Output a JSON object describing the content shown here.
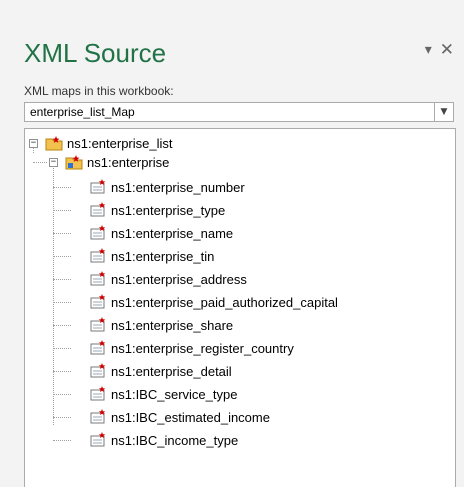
{
  "pane": {
    "title": "XML Source",
    "maps_label": "XML maps in this workbook:",
    "selected_map": "enterprise_list_Map"
  },
  "tree": {
    "root": "ns1:enterprise_list",
    "child": "ns1:enterprise",
    "fields": [
      "ns1:enterprise_number",
      "ns1:enterprise_type",
      "ns1:enterprise_name",
      "ns1:enterprise_tin",
      "ns1:enterprise_address",
      "ns1:enterprise_paid_authorized_capital",
      "ns1:enterprise_share",
      "ns1:enterprise_register_country",
      "ns1:enterprise_detail",
      "ns1:IBC_service_type",
      "ns1:IBC_estimated_income",
      "ns1:IBC_income_type"
    ]
  },
  "colors": {
    "title": "#217346",
    "folder": "#f2c14e",
    "required_star": "#d40000"
  }
}
